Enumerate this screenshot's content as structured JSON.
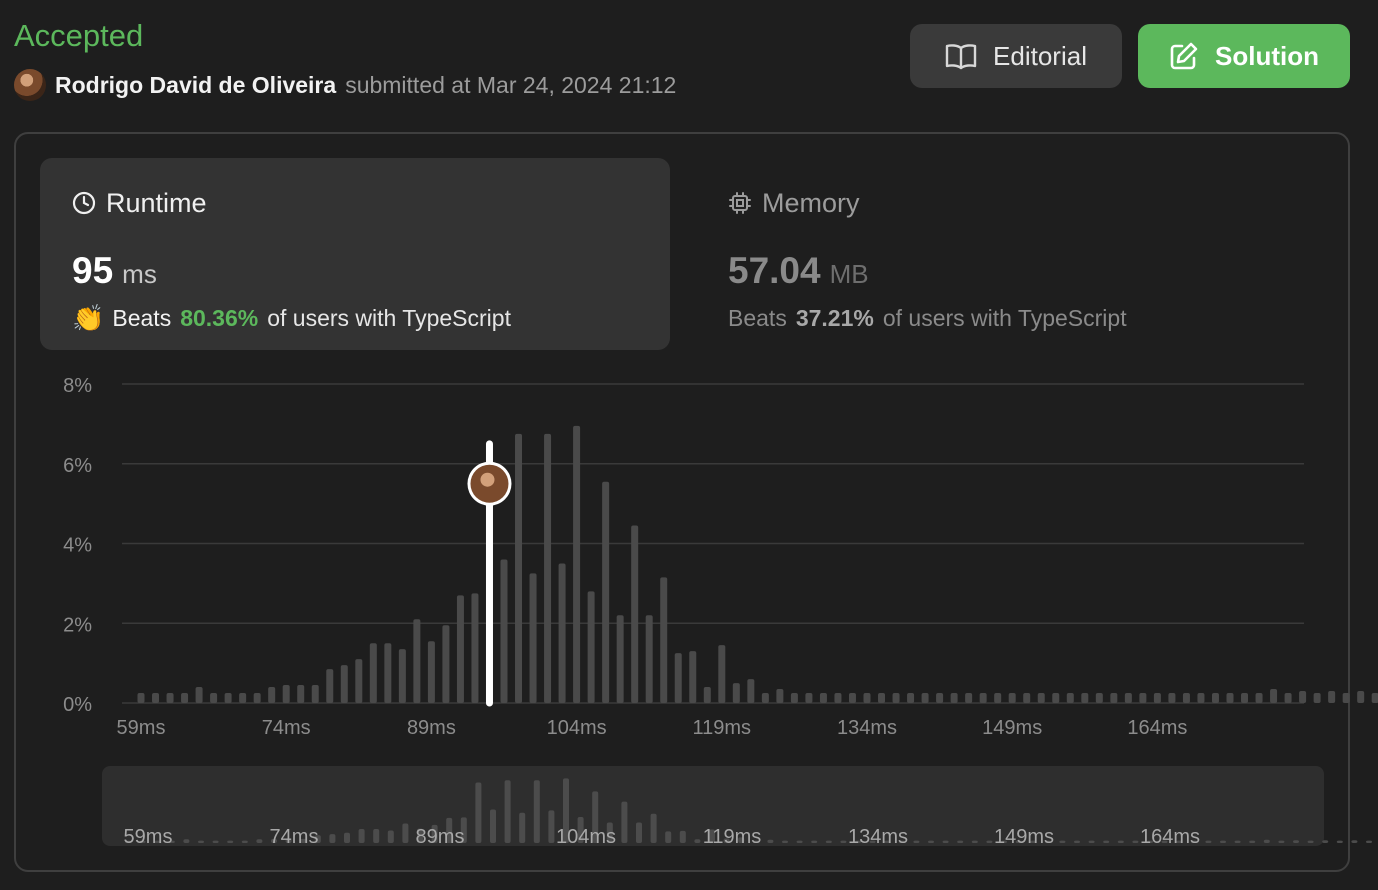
{
  "header": {
    "status": "Accepted",
    "user_name": "Rodrigo David de Oliveira",
    "submitted_text": "submitted at Mar 24, 2024 21:12",
    "editorial_label": "Editorial",
    "solution_label": "Solution"
  },
  "runtime": {
    "title": "Runtime",
    "value": "95",
    "unit": "ms",
    "beats_label": "Beats",
    "beats_pct": "80.36%",
    "beats_suffix": "of users with TypeScript"
  },
  "memory": {
    "title": "Memory",
    "value": "57.04",
    "unit": "MB",
    "beats_label": "Beats",
    "beats_pct": "37.21%",
    "beats_suffix": "of users with TypeScript"
  },
  "colors": {
    "accent_green": "#5cb85c",
    "bar": "#4a4a4a",
    "background": "#1e1e1e"
  },
  "icons": {
    "editorial": "book-open-icon",
    "solution": "pencil-square-icon",
    "runtime": "clock-icon",
    "memory": "cpu-chip-icon",
    "beats": "clapping-hands-icon"
  },
  "chart_data": {
    "type": "bar",
    "title": "",
    "xlabel": "",
    "ylabel": "",
    "ylim": [
      0,
      8
    ],
    "grid": true,
    "y_ticks": [
      "0%",
      "2%",
      "4%",
      "6%",
      "8%"
    ],
    "x_ticks": [
      "59ms",
      "74ms",
      "89ms",
      "104ms",
      "119ms",
      "134ms",
      "149ms",
      "164ms"
    ],
    "x_start_ms": 59,
    "x_step_ms": 1.5,
    "marker_ms": 95,
    "values": [
      0.25,
      0.25,
      0.25,
      0.25,
      0.4,
      0.25,
      0.25,
      0.25,
      0.25,
      0.4,
      0.45,
      0.45,
      0.45,
      0.85,
      0.95,
      1.1,
      1.5,
      1.5,
      1.35,
      2.1,
      1.55,
      1.95,
      2.7,
      2.75,
      6.5,
      3.6,
      6.75,
      3.25,
      6.75,
      3.5,
      6.95,
      2.8,
      5.55,
      2.2,
      4.45,
      2.2,
      3.15,
      1.25,
      1.3,
      0.4,
      1.45,
      0.5,
      0.6,
      0.25,
      0.35,
      0.25,
      0.25,
      0.25,
      0.25,
      0.25,
      0.25,
      0.25,
      0.25,
      0.25,
      0.25,
      0.25,
      0.25,
      0.25,
      0.25,
      0.25,
      0.25,
      0.25,
      0.25,
      0.25,
      0.25,
      0.25,
      0.25,
      0.25,
      0.25,
      0.25,
      0.25,
      0.25,
      0.25,
      0.25,
      0.25,
      0.25,
      0.25,
      0.25,
      0.35,
      0.25,
      0.3,
      0.25,
      0.3,
      0.25,
      0.3,
      0.25,
      0.25,
      0.4,
      0.25,
      0.5,
      0.25
    ]
  }
}
